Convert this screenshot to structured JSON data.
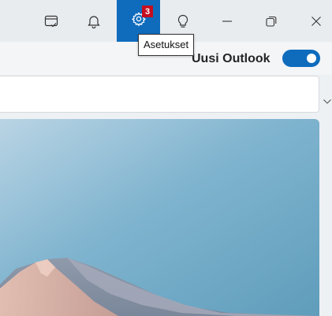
{
  "titlebar": {
    "icons": [
      "task-check-icon",
      "bell-icon",
      "gear-icon",
      "lightbulb-icon",
      "minimize-icon",
      "restore-icon",
      "close-icon"
    ],
    "settings_badge": "3",
    "accent_color": "#0f6cbd",
    "badge_color": "#c50f1f"
  },
  "tooltip": {
    "text": "Asetukset"
  },
  "header": {
    "new_outlook_label": "Uusi Outlook",
    "toggle_on": true
  },
  "search": {
    "value": "",
    "placeholder": ""
  }
}
